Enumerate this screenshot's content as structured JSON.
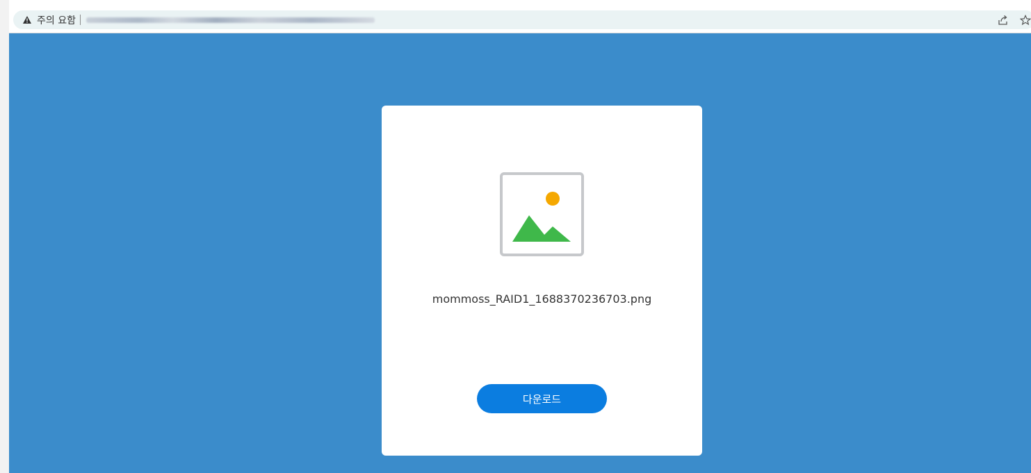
{
  "browser": {
    "security_label": "주의 요함",
    "security_icon": "warning-triangle-icon",
    "toolbar_icons": [
      "share-icon",
      "bookmark-star-icon"
    ]
  },
  "page": {
    "file_icon": "image-file-icon",
    "file_name": "mommoss_RAID1_1688370236703.png",
    "download_label": "다운로드"
  },
  "colors": {
    "page_background": "#3b8ccb",
    "card_background": "#ffffff",
    "button_background": "#0b7de0",
    "image_sun": "#f5a800",
    "image_mountains": "#3fb84a",
    "image_frame": "#c6c8cb"
  }
}
